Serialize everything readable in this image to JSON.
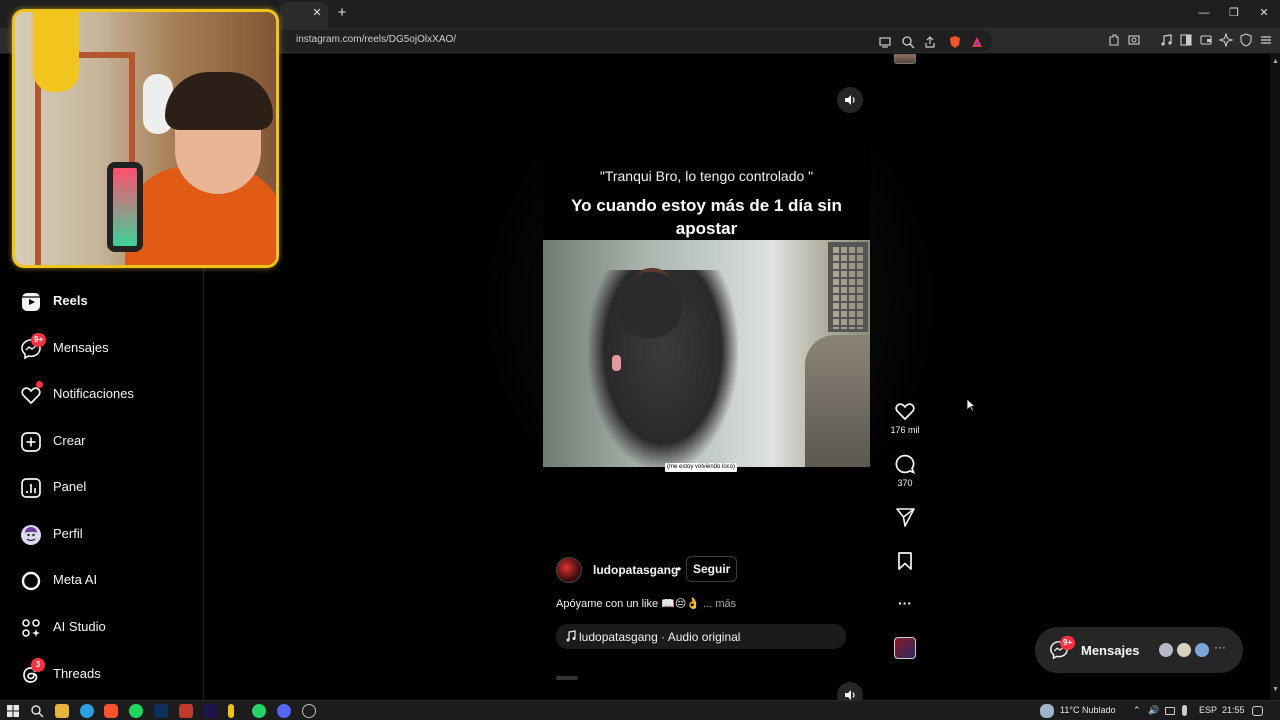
{
  "browser": {
    "url": "instagram.com/reels/DG5ojOlxXAO/",
    "tab_close": "✕",
    "new_tab": "+",
    "window_minimize": "—",
    "window_restore": "❐",
    "window_close": "✕"
  },
  "sidebar": {
    "items": [
      {
        "label": "Reels",
        "icon": "reels-icon",
        "active": true
      },
      {
        "label": "Mensajes",
        "icon": "messenger-icon",
        "badge": "9+"
      },
      {
        "label": "Notificaciones",
        "icon": "heart-icon",
        "dot": true
      },
      {
        "label": "Crear",
        "icon": "plus-square-icon"
      },
      {
        "label": "Panel",
        "icon": "bar-chart-icon"
      },
      {
        "label": "Perfil",
        "icon": "avatar-icon"
      },
      {
        "label": "Meta AI",
        "icon": "meta-ai-ring-icon"
      },
      {
        "label": "AI Studio",
        "icon": "ai-studio-icon"
      },
      {
        "label": "Threads",
        "icon": "threads-icon",
        "badge": "3"
      }
    ]
  },
  "reel": {
    "caption_top": "\"Tranqui Bro, lo tengo controlado \"",
    "caption_main": "Yo cuando estoy más de 1 día sin apostar",
    "video_subtitle": "(me estoy volviendo loco)",
    "author": "ludopatasgang",
    "author_separator": "•",
    "follow_label": "Seguir",
    "description": "Apóyame con un like 📖😔👌",
    "more_label": "... más",
    "audio": "ludopatasgang · Audio original"
  },
  "actions": {
    "likes": "176 mil",
    "comments": "370",
    "more": "···"
  },
  "messages_pill": {
    "label": "Mensajes",
    "badge": "9+",
    "more": "···"
  },
  "taskbar": {
    "weather": "11°C  Nublado",
    "language": "ESP",
    "time": "21:55"
  },
  "colors": {
    "accent_red": "#ff3040",
    "webcam_border": "#f0c41a",
    "background": "#000000"
  }
}
